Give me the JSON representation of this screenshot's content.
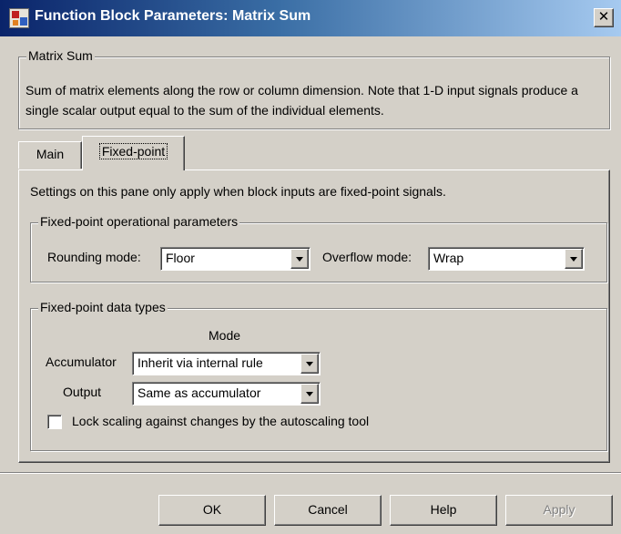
{
  "window": {
    "title": "Function Block Parameters: Matrix Sum",
    "close_glyph": "✕",
    "icon": "simulink-block-icon"
  },
  "block": {
    "group_title": "Matrix Sum",
    "description": "Sum of matrix elements along the row or column dimension. Note that 1-D input signals produce a single scalar output equal to the sum of the individual elements."
  },
  "tabs": [
    {
      "label": "Main",
      "selected": false
    },
    {
      "label": "Fixed-point",
      "selected": true
    }
  ],
  "fixed_point": {
    "intro": "Settings on this pane only apply when block inputs are fixed-point signals.",
    "operational": {
      "title": "Fixed-point operational parameters",
      "rounding_label": "Rounding mode:",
      "rounding_value": "Floor",
      "overflow_label": "Overflow mode:",
      "overflow_value": "Wrap"
    },
    "data_types": {
      "title": "Fixed-point data types",
      "mode_header": "Mode",
      "accumulator_label": "Accumulator",
      "accumulator_value": "Inherit via internal rule",
      "output_label": "Output",
      "output_value": "Same as accumulator",
      "lock_scaling_label": "Lock scaling against changes by the autoscaling tool",
      "lock_scaling_checked": false
    }
  },
  "buttons": {
    "ok": "OK",
    "cancel": "Cancel",
    "help": "Help",
    "apply": "Apply"
  }
}
